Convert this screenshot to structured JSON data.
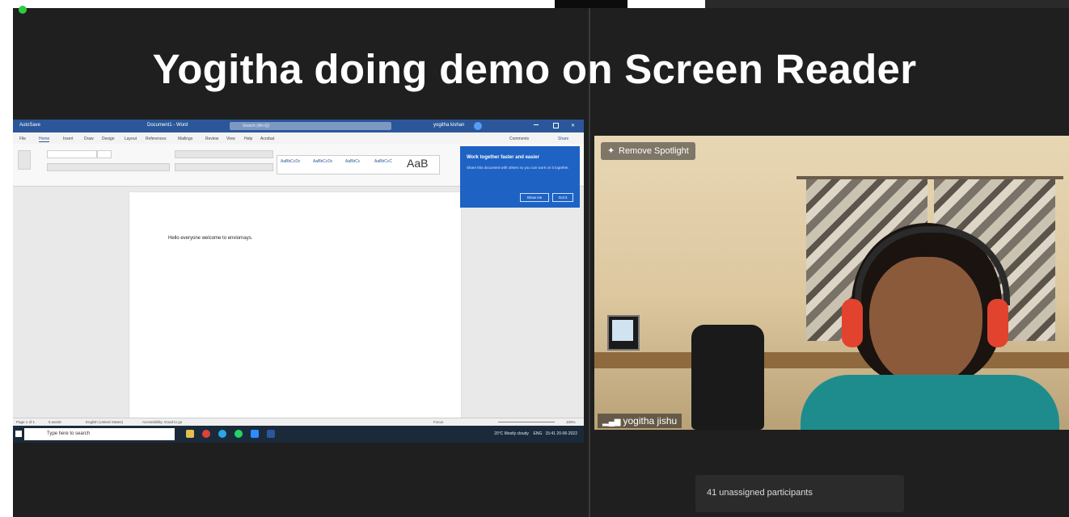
{
  "meeting": {
    "title": "Yogitha doing demo on Screen Reader",
    "participants_label": "41 unassigned participants"
  },
  "video_tile": {
    "remove_spotlight_label": "Remove Spotlight",
    "participant_name": "yogitha jishu"
  },
  "word_app": {
    "title_left": "AutoSave",
    "document_title": "Document1 - Word",
    "search_placeholder": "Search (Alt+Q)",
    "user_name": "yogitha kishan",
    "menu": [
      "File",
      "Home",
      "Insert",
      "Draw",
      "Design",
      "Layout",
      "References",
      "Mailings",
      "Review",
      "View",
      "Help",
      "Acrobat"
    ],
    "comments_label": "Comments",
    "share_label": "Share",
    "styles": [
      "AaBbCcDc",
      "AaBbCcDc",
      "AaBbCc",
      "AaBbCcC",
      "AaB"
    ],
    "ribbon_labels": [
      "Clipboard",
      "Font",
      "Paragraph",
      "Styles"
    ],
    "document_text": "Hello everyone welcome to enviornays.",
    "popup": {
      "title": "Work together faster and easier",
      "body": "Share this document with others so you can work on it together.",
      "show_me": "Show me",
      "got_it": "Got it"
    },
    "status_bar": {
      "page": "Page 1 of 1",
      "words": "5 words",
      "language": "English (United States)",
      "accessibility": "Accessibility: Good to go",
      "focus": "Focus",
      "zoom": "100%"
    }
  },
  "taskbar": {
    "search_placeholder": "Type here to search",
    "weather": "20°C Mostly cloudy",
    "language": "ENG",
    "time": "15:41",
    "date": "20-06-2022"
  },
  "colors": {
    "zoom_bg": "#1f1f1f",
    "word_blue": "#2b579a",
    "popup_blue": "#1e63c4"
  }
}
